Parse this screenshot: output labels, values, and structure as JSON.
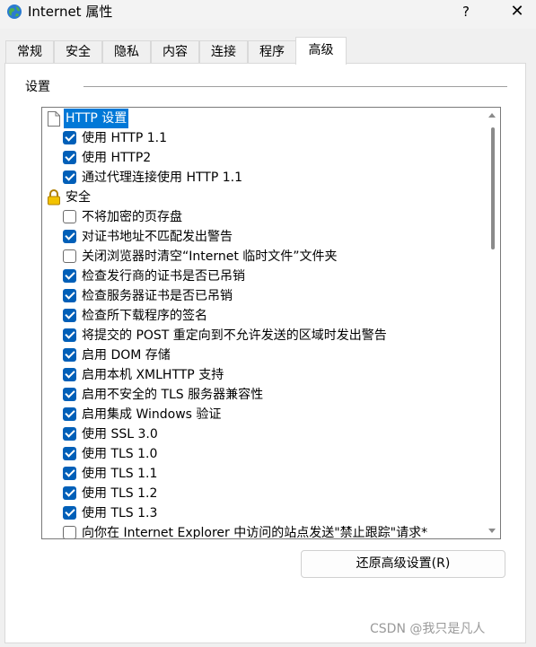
{
  "window": {
    "title": "Internet 属性",
    "help": "?",
    "close": "✕"
  },
  "tabs": [
    "常规",
    "安全",
    "隐私",
    "内容",
    "连接",
    "程序",
    "高级"
  ],
  "settings": {
    "group_label": "设置",
    "items": [
      {
        "kind": "category",
        "icon": "document-icon",
        "label": "HTTP 设置",
        "selected": true
      },
      {
        "kind": "checkbox",
        "checked": true,
        "label": "使用 HTTP 1.1"
      },
      {
        "kind": "checkbox",
        "checked": true,
        "label": "使用 HTTP2"
      },
      {
        "kind": "checkbox",
        "checked": true,
        "label": "通过代理连接使用 HTTP 1.1"
      },
      {
        "kind": "category",
        "icon": "lock-icon",
        "label": "安全",
        "selected": false
      },
      {
        "kind": "checkbox",
        "checked": false,
        "label": "不将加密的页存盘"
      },
      {
        "kind": "checkbox",
        "checked": true,
        "label": "对证书地址不匹配发出警告"
      },
      {
        "kind": "checkbox",
        "checked": false,
        "label": "关闭浏览器时清空“Internet 临时文件”文件夹"
      },
      {
        "kind": "checkbox",
        "checked": true,
        "label": "检查发行商的证书是否已吊销"
      },
      {
        "kind": "checkbox",
        "checked": true,
        "label": "检查服务器证书是否已吊销"
      },
      {
        "kind": "checkbox",
        "checked": true,
        "label": "检查所下载程序的签名"
      },
      {
        "kind": "checkbox",
        "checked": true,
        "label": "将提交的 POST 重定向到不允许发送的区域时发出警告"
      },
      {
        "kind": "checkbox",
        "checked": true,
        "label": "启用 DOM 存储"
      },
      {
        "kind": "checkbox",
        "checked": true,
        "label": "启用本机 XMLHTTP 支持"
      },
      {
        "kind": "checkbox",
        "checked": true,
        "label": "启用不安全的 TLS 服务器兼容性"
      },
      {
        "kind": "checkbox",
        "checked": true,
        "label": "启用集成 Windows 验证"
      },
      {
        "kind": "checkbox",
        "checked": true,
        "label": "使用 SSL 3.0"
      },
      {
        "kind": "checkbox",
        "checked": true,
        "label": "使用 TLS 1.0"
      },
      {
        "kind": "checkbox",
        "checked": true,
        "label": "使用 TLS 1.1"
      },
      {
        "kind": "checkbox",
        "checked": true,
        "label": "使用 TLS 1.2"
      },
      {
        "kind": "checkbox",
        "checked": true,
        "label": "使用 TLS 1.3"
      },
      {
        "kind": "checkbox",
        "checked": false,
        "label": "向你在 Internet Explorer 中访问的站点发送\"禁止跟踪\"请求*"
      }
    ]
  },
  "restore_button": "还原高级设置(R)",
  "watermark": "CSDN @我只是凡人",
  "colors": {
    "checkbox_checked": "#005fb8",
    "selection": "#0078d7"
  }
}
